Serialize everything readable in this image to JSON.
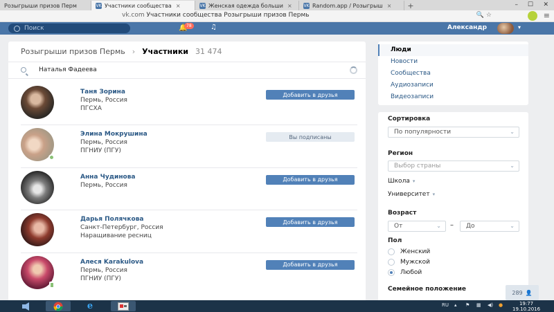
{
  "browser": {
    "tabs": [
      {
        "title": "Розыгрыши призов Перм",
        "active": false
      },
      {
        "title": "Участники сообщества",
        "active": true
      },
      {
        "title": "Женская одежда больши",
        "active": false
      },
      {
        "title": "Random.app / Розыгрыш",
        "active": false
      }
    ],
    "address_domain": "vk.com",
    "address_title": "Участники сообщества Розыгрыши призов Пермь"
  },
  "header": {
    "search_placeholder": "Поиск",
    "notifications_count": "78",
    "user_name": "Александр"
  },
  "page": {
    "breadcrumb_group": "Розыгрыши призов Пермь",
    "breadcrumb_current": "Участники",
    "member_count": "31 474",
    "search_value": "Наталья Фадеева"
  },
  "people": [
    {
      "name": "Таня Зорина",
      "line1": "Пермь, Россия",
      "line2": "ПГСХА",
      "button": "Добавить в друзья",
      "button_type": "primary"
    },
    {
      "name": "Элина Мокрушина",
      "line1": "Пермь, Россия",
      "line2": "ПГНИУ (ПГУ)",
      "button": "Вы подписаны",
      "button_type": "secondary"
    },
    {
      "name": "Анна Чудинова",
      "line1": "Пермь, Россия",
      "line2": "",
      "button": "Добавить в друзья",
      "button_type": "primary"
    },
    {
      "name": "Дарья Полячкова",
      "line1": "Санкт-Петербург, Россия",
      "line2": "Наращивание ресниц",
      "button": "Добавить в друзья",
      "button_type": "primary"
    },
    {
      "name": "Алеся Karakulova",
      "line1": "Пермь, Россия",
      "line2": "ПГНИУ (ПГУ)",
      "button": "Добавить в друзья",
      "button_type": "primary"
    }
  ],
  "nav": {
    "items": [
      "Люди",
      "Новости",
      "Сообщества",
      "Аудиозаписи",
      "Видеозаписи"
    ]
  },
  "filters": {
    "sort_label": "Сортировка",
    "sort_value": "По популярности",
    "region_label": "Регион",
    "region_placeholder": "Выбор страны",
    "school_label": "Школа",
    "university_label": "Университет",
    "age_label": "Возраст",
    "age_from": "От",
    "age_to": "До",
    "age_dash": "–",
    "gender_label": "Пол",
    "gender_options": [
      "Женский",
      "Мужской",
      "Любой"
    ],
    "gender_selected": "Любой",
    "marital_label": "Семейное положение"
  },
  "scroll_counter": "289",
  "taskbar": {
    "lang": "RU",
    "time": "19:77",
    "date": "19.10.2016"
  }
}
